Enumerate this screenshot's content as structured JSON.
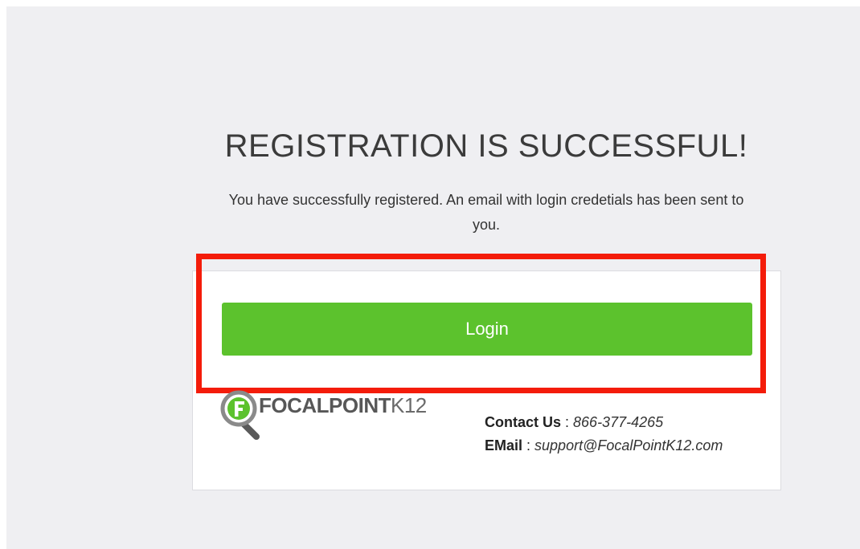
{
  "page": {
    "heading": "REGISTRATION IS SUCCESSFUL!",
    "message_line1": "You have successfully registered. An email with login credetials has been sent to",
    "message_line2": "you."
  },
  "card": {
    "login_label": "Login",
    "logo": {
      "icon": "magnifier-f-logo-icon",
      "brand_bold": "FOCALPOINT",
      "brand_light": "K12"
    },
    "contact": {
      "phone_label": "Contact Us",
      "separator": " : ",
      "phone": "866-377-4265",
      "email_label": "EMail",
      "email": "support@FocalPointK12.com"
    }
  },
  "colors": {
    "background": "#efeff2",
    "button": "#5cc22d",
    "highlight": "#f41c0a",
    "logo_green": "#5cc22d",
    "logo_gray": "#575757"
  }
}
